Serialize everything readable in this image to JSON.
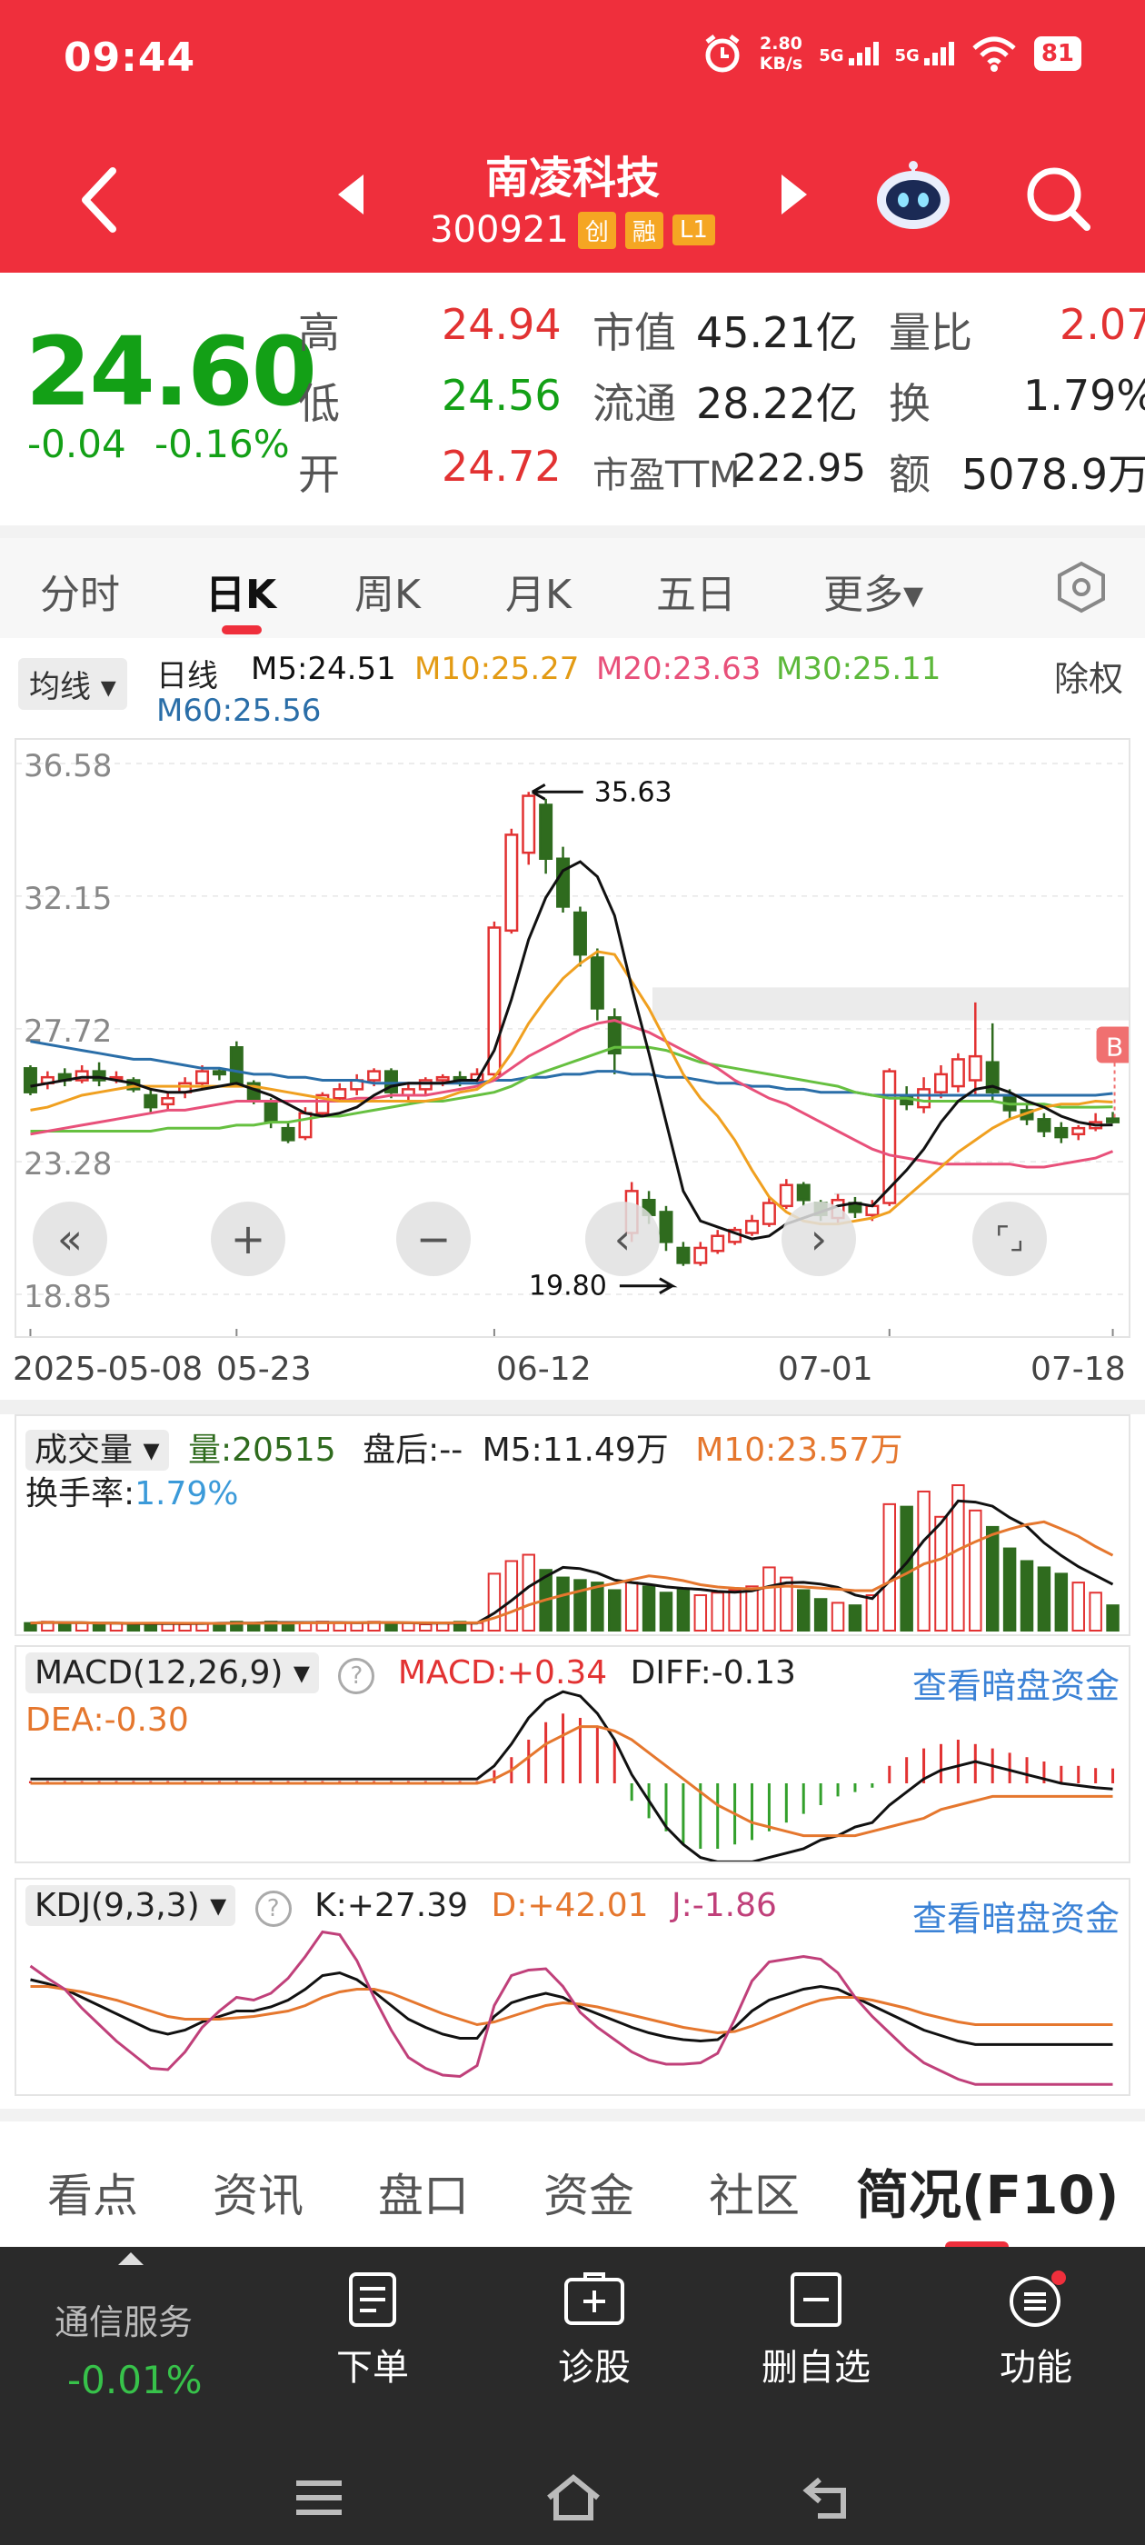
{
  "status": {
    "time": "09:44",
    "net_speed_top": "2.80",
    "net_speed_bottom": "KB/s",
    "sig1": "5G",
    "sig2": "5G",
    "battery": "81"
  },
  "header": {
    "name": "南凌科技",
    "code": "300921",
    "tags": [
      "创",
      "融",
      "L1"
    ]
  },
  "quote": {
    "price": "24.60",
    "change": "-0.04",
    "change_pct": "-0.16%",
    "high_label": "高",
    "high": "24.94",
    "low_label": "低",
    "low": "24.56",
    "open_label": "开",
    "open": "24.72",
    "mcap_label": "市值",
    "mcap": "45.21亿",
    "float_label": "流通",
    "float": "28.22亿",
    "pe_label": "市盈TTM",
    "pe": "222.95",
    "vr_label": "量比",
    "vr": "2.07",
    "turn_label": "换",
    "turn": "1.79%",
    "amt_label": "额",
    "amt": "5078.9万"
  },
  "period_tabs": [
    "分时",
    "日K",
    "周K",
    "月K",
    "五日",
    "更多▾"
  ],
  "ma_legend": {
    "select": "均线 ▾",
    "period": "日线",
    "m5": "M5:24.51",
    "m10": "M10:25.27",
    "m20": "M20:23.63",
    "m30": "M30:25.11",
    "m60": "M60:25.56",
    "fq": "除权"
  },
  "colors": {
    "brand": "#ef2f3c",
    "up": "#e23232",
    "down": "#2f6b1e",
    "ma5": "#111111",
    "ma10": "#f0a020",
    "ma20": "#e8507a",
    "ma30": "#66c040",
    "ma60": "#2a6ea8",
    "blue_link": "#3b82d6"
  },
  "chart_data": {
    "type": "candlestick",
    "y_ticks": [
      "36.58",
      "32.15",
      "27.72",
      "23.28",
      "18.85"
    ],
    "ylim": [
      18.85,
      36.58
    ],
    "x_labels": [
      "2025-05-08",
      "05-23",
      "06-12",
      "07-01",
      "07-18"
    ],
    "max_label": "35.63",
    "min_label": "19.80",
    "badge": "B",
    "candles": [
      [
        26.4,
        25.6,
        26.5,
        25.5
      ],
      [
        25.9,
        26.1,
        26.3,
        25.7
      ],
      [
        26.2,
        26.0,
        26.4,
        25.8
      ],
      [
        26.0,
        26.3,
        26.5,
        25.9
      ],
      [
        26.3,
        26.0,
        26.6,
        25.8
      ],
      [
        26.1,
        26.1,
        26.3,
        25.9
      ],
      [
        26.0,
        25.7,
        26.1,
        25.6
      ],
      [
        25.5,
        25.1,
        25.7,
        24.9
      ],
      [
        25.2,
        25.4,
        25.6,
        25.0
      ],
      [
        25.6,
        25.9,
        26.1,
        25.4
      ],
      [
        25.9,
        26.3,
        26.5,
        25.7
      ],
      [
        26.3,
        26.2,
        26.4,
        26.0
      ],
      [
        27.1,
        25.9,
        27.3,
        25.8
      ],
      [
        25.9,
        25.3,
        26.0,
        25.2
      ],
      [
        25.3,
        24.6,
        25.4,
        24.4
      ],
      [
        24.4,
        24.0,
        24.6,
        23.9
      ],
      [
        24.1,
        24.9,
        25.1,
        24.0
      ],
      [
        24.9,
        25.5,
        25.6,
        24.8
      ],
      [
        25.4,
        25.7,
        25.9,
        25.3
      ],
      [
        25.7,
        26.0,
        26.2,
        25.5
      ],
      [
        26.0,
        26.3,
        26.4,
        25.8
      ],
      [
        26.3,
        25.6,
        26.4,
        25.4
      ],
      [
        25.5,
        25.7,
        25.9,
        25.3
      ],
      [
        25.7,
        26.0,
        26.1,
        25.5
      ],
      [
        26.0,
        26.1,
        26.2,
        25.8
      ],
      [
        26.1,
        26.0,
        26.3,
        25.8
      ],
      [
        26.0,
        26.2,
        26.4,
        25.9
      ],
      [
        26.2,
        31.1,
        31.3,
        26.1
      ],
      [
        31.0,
        34.2,
        34.4,
        30.9
      ],
      [
        33.6,
        35.5,
        35.63,
        33.2
      ],
      [
        35.2,
        33.4,
        35.4,
        32.9
      ],
      [
        33.4,
        31.8,
        33.8,
        31.6
      ],
      [
        31.6,
        30.2,
        31.8,
        29.8
      ],
      [
        30.1,
        28.4,
        30.4,
        28.0
      ],
      [
        28.1,
        26.9,
        28.4,
        26.2
      ],
      [
        20.9,
        22.3,
        22.6,
        20.6
      ],
      [
        22.0,
        21.5,
        22.3,
        21.2
      ],
      [
        21.6,
        20.6,
        21.8,
        20.3
      ],
      [
        20.4,
        19.9,
        20.6,
        19.8
      ],
      [
        19.9,
        20.4,
        20.6,
        19.8
      ],
      [
        20.3,
        20.8,
        21.0,
        20.2
      ],
      [
        20.6,
        21.0,
        21.1,
        20.5
      ],
      [
        20.9,
        21.3,
        21.5,
        20.8
      ],
      [
        21.2,
        21.9,
        22.1,
        21.1
      ],
      [
        21.8,
        22.5,
        22.7,
        21.7
      ],
      [
        22.5,
        22.0,
        22.6,
        21.8
      ],
      [
        21.9,
        21.5,
        22.0,
        21.3
      ],
      [
        21.4,
        22.0,
        22.2,
        21.2
      ],
      [
        21.9,
        21.6,
        22.1,
        21.4
      ],
      [
        21.5,
        21.8,
        22.0,
        21.3
      ],
      [
        21.9,
        26.3,
        26.4,
        21.8
      ],
      [
        25.5,
        25.2,
        25.8,
        25.0
      ],
      [
        25.1,
        25.7,
        26.1,
        24.9
      ],
      [
        25.6,
        26.2,
        26.5,
        25.4
      ],
      [
        25.8,
        26.7,
        26.9,
        25.6
      ],
      [
        26.0,
        26.8,
        28.6,
        25.5
      ],
      [
        26.6,
        25.6,
        27.9,
        25.3
      ],
      [
        25.5,
        25.0,
        25.7,
        24.7
      ],
      [
        25.0,
        24.7,
        25.2,
        24.5
      ],
      [
        24.7,
        24.3,
        24.9,
        24.1
      ],
      [
        24.4,
        24.1,
        24.6,
        23.9
      ],
      [
        24.2,
        24.4,
        24.5,
        24.0
      ],
      [
        24.4,
        24.6,
        24.9,
        24.3
      ],
      [
        24.72,
        24.6,
        24.94,
        24.56
      ]
    ],
    "ma5": [
      25.8,
      25.9,
      26.0,
      26.1,
      26.1,
      26.0,
      25.9,
      25.7,
      25.6,
      25.6,
      25.7,
      25.8,
      25.9,
      25.7,
      25.5,
      25.2,
      24.9,
      24.8,
      24.9,
      25.1,
      25.5,
      25.8,
      25.9,
      25.9,
      25.9,
      26.0,
      26.0,
      27.0,
      28.7,
      30.7,
      32.1,
      33.0,
      33.3,
      32.8,
      31.5,
      29.1,
      26.9,
      24.6,
      22.3,
      21.3,
      21.1,
      20.9,
      20.7,
      20.8,
      21.2,
      21.4,
      21.6,
      21.8,
      21.9,
      21.8,
      22.4,
      23.0,
      23.7,
      24.6,
      25.3,
      25.7,
      25.8,
      25.6,
      25.3,
      25.1,
      24.8,
      24.6,
      24.5,
      24.51
    ],
    "ma10": [
      25.0,
      25.1,
      25.3,
      25.5,
      25.6,
      25.7,
      25.8,
      25.8,
      25.8,
      25.8,
      25.8,
      25.8,
      25.8,
      25.8,
      25.7,
      25.6,
      25.5,
      25.4,
      25.3,
      25.3,
      25.3,
      25.3,
      25.3,
      25.3,
      25.4,
      25.6,
      25.7,
      26.1,
      26.9,
      27.9,
      28.7,
      29.4,
      29.9,
      30.3,
      30.2,
      29.3,
      28.4,
      27.3,
      26.2,
      25.4,
      24.8,
      24.0,
      23.0,
      22.1,
      21.6,
      21.3,
      21.2,
      21.2,
      21.3,
      21.4,
      21.6,
      22.1,
      22.6,
      23.1,
      23.6,
      24.0,
      24.4,
      24.7,
      24.9,
      25.1,
      25.2,
      25.2,
      25.3,
      25.27
    ],
    "ma20": [
      24.2,
      24.3,
      24.4,
      24.5,
      24.6,
      24.7,
      24.8,
      24.9,
      25.0,
      25.0,
      25.1,
      25.2,
      25.3,
      25.3,
      25.3,
      25.3,
      25.3,
      25.3,
      25.3,
      25.4,
      25.4,
      25.5,
      25.5,
      25.5,
      25.6,
      25.7,
      25.8,
      26.0,
      26.4,
      26.8,
      27.1,
      27.4,
      27.7,
      27.9,
      28.0,
      27.8,
      27.6,
      27.3,
      27.0,
      26.7,
      26.4,
      26.0,
      25.7,
      25.4,
      25.2,
      24.9,
      24.6,
      24.3,
      24.0,
      23.7,
      23.5,
      23.4,
      23.3,
      23.2,
      23.2,
      23.2,
      23.2,
      23.2,
      23.1,
      23.1,
      23.2,
      23.3,
      23.4,
      23.63
    ],
    "ma30": [
      24.3,
      24.3,
      24.3,
      24.3,
      24.3,
      24.3,
      24.3,
      24.3,
      24.4,
      24.4,
      24.4,
      24.4,
      24.5,
      24.5,
      24.6,
      24.6,
      24.7,
      24.8,
      24.8,
      24.9,
      25.0,
      25.1,
      25.2,
      25.3,
      25.3,
      25.4,
      25.5,
      25.6,
      25.8,
      26.1,
      26.3,
      26.5,
      26.7,
      26.9,
      27.1,
      27.1,
      27.1,
      27.0,
      26.8,
      26.6,
      26.5,
      26.4,
      26.3,
      26.2,
      26.1,
      26.0,
      25.9,
      25.8,
      25.6,
      25.5,
      25.4,
      25.4,
      25.3,
      25.3,
      25.3,
      25.3,
      25.3,
      25.2,
      25.2,
      25.2,
      25.1,
      25.1,
      25.1,
      25.11
    ],
    "ma60": [
      27.3,
      27.2,
      27.1,
      27.0,
      26.9,
      26.8,
      26.7,
      26.7,
      26.6,
      26.5,
      26.4,
      26.4,
      26.3,
      26.2,
      26.2,
      26.1,
      26.1,
      26.0,
      26.0,
      26.0,
      25.9,
      25.9,
      25.9,
      25.9,
      25.9,
      25.9,
      25.9,
      26.0,
      26.0,
      26.1,
      26.1,
      26.2,
      26.2,
      26.3,
      26.3,
      26.2,
      26.2,
      26.1,
      26.1,
      26.0,
      25.9,
      25.9,
      25.8,
      25.8,
      25.7,
      25.7,
      25.6,
      25.6,
      25.6,
      25.5,
      25.5,
      25.5,
      25.5,
      25.5,
      25.5,
      25.5,
      25.5,
      25.5,
      25.5,
      25.5,
      25.5,
      25.5,
      25.5,
      25.56
    ],
    "volume": [
      6,
      7,
      6,
      6,
      5,
      6,
      5,
      6,
      6,
      5,
      6,
      6,
      7,
      6,
      7,
      6,
      6,
      7,
      6,
      6,
      7,
      6,
      6,
      5,
      6,
      7,
      6,
      45,
      55,
      60,
      48,
      42,
      40,
      38,
      32,
      38,
      35,
      30,
      32,
      28,
      30,
      32,
      35,
      50,
      42,
      32,
      25,
      22,
      20,
      28,
      100,
      98,
      110,
      90,
      115,
      95,
      82,
      65,
      55,
      50,
      45,
      38,
      30,
      20
    ],
    "macd_hist": [
      0.05,
      0.05,
      0.05,
      0.05,
      0.05,
      0.05,
      0.05,
      0.05,
      0.05,
      0.05,
      0.05,
      0.05,
      0.05,
      0.05,
      0.05,
      0.05,
      0.05,
      0.05,
      0.05,
      0.05,
      0.05,
      0.05,
      0.05,
      0.05,
      0.05,
      0.05,
      0.05,
      0.3,
      0.6,
      1.0,
      1.4,
      1.6,
      1.5,
      1.3,
      1.0,
      -0.4,
      -0.8,
      -1.1,
      -1.4,
      -1.5,
      -1.5,
      -1.4,
      -1.3,
      -1.1,
      -0.9,
      -0.7,
      -0.5,
      -0.3,
      -0.2,
      -0.1,
      0.4,
      0.6,
      0.8,
      0.9,
      1.0,
      0.9,
      0.8,
      0.7,
      0.6,
      0.5,
      0.4,
      0.4,
      0.35,
      0.34
    ],
    "diff": [
      0.1,
      0.1,
      0.1,
      0.1,
      0.1,
      0.1,
      0.1,
      0.1,
      0.1,
      0.1,
      0.1,
      0.1,
      0.1,
      0.1,
      0.1,
      0.1,
      0.1,
      0.1,
      0.1,
      0.1,
      0.1,
      0.1,
      0.1,
      0.1,
      0.1,
      0.1,
      0.1,
      0.4,
      0.9,
      1.5,
      1.9,
      2.1,
      2.0,
      1.6,
      1.0,
      0.2,
      -0.4,
      -1.0,
      -1.4,
      -1.7,
      -1.8,
      -1.8,
      -1.8,
      -1.7,
      -1.6,
      -1.5,
      -1.3,
      -1.2,
      -1.0,
      -0.9,
      -0.5,
      -0.2,
      0.1,
      0.3,
      0.4,
      0.5,
      0.4,
      0.3,
      0.2,
      0.1,
      0.0,
      -0.05,
      -0.1,
      -0.13
    ],
    "dea": [
      0.0,
      0.0,
      0.0,
      0.0,
      0.0,
      0.0,
      0.0,
      0.0,
      0.0,
      0.0,
      0.0,
      0.0,
      0.0,
      0.0,
      0.0,
      0.0,
      0.0,
      0.0,
      0.0,
      0.0,
      0.0,
      0.0,
      0.0,
      0.0,
      0.0,
      0.0,
      0.0,
      0.1,
      0.3,
      0.6,
      0.9,
      1.1,
      1.3,
      1.3,
      1.2,
      1.0,
      0.7,
      0.4,
      0.1,
      -0.2,
      -0.5,
      -0.7,
      -0.9,
      -1.0,
      -1.1,
      -1.2,
      -1.2,
      -1.2,
      -1.2,
      -1.1,
      -1.0,
      -0.9,
      -0.8,
      -0.6,
      -0.5,
      -0.4,
      -0.3,
      -0.3,
      -0.3,
      -0.3,
      -0.3,
      -0.3,
      -0.3,
      -0.3
    ],
    "kdj_k": [
      75,
      72,
      68,
      62,
      56,
      50,
      44,
      38,
      35,
      38,
      44,
      48,
      52,
      52,
      55,
      60,
      68,
      78,
      80,
      75,
      66,
      56,
      46,
      40,
      35,
      32,
      32,
      48,
      58,
      62,
      65,
      62,
      55,
      50,
      45,
      40,
      36,
      33,
      31,
      30,
      31,
      40,
      52,
      60,
      64,
      68,
      70,
      68,
      62,
      56,
      50,
      44,
      38,
      34,
      30,
      27.39,
      27.4,
      27.4,
      27.4,
      27.4,
      27.4,
      27.4,
      27.4,
      27.39
    ],
    "kdj_d": [
      70,
      70,
      68,
      66,
      63,
      60,
      56,
      52,
      48,
      46,
      46,
      46,
      47,
      48,
      50,
      52,
      56,
      62,
      66,
      68,
      68,
      65,
      60,
      55,
      50,
      46,
      42,
      44,
      48,
      52,
      56,
      58,
      57,
      55,
      52,
      49,
      46,
      43,
      40,
      38,
      36,
      37,
      41,
      46,
      51,
      56,
      60,
      62,
      62,
      60,
      57,
      54,
      50,
      47,
      44,
      42.01,
      42,
      42,
      42,
      42,
      42,
      42,
      42,
      42.01
    ],
    "kdj_j": [
      85,
      76,
      68,
      54,
      42,
      30,
      20,
      10,
      9,
      22,
      40,
      52,
      62,
      60,
      65,
      76,
      92,
      110,
      108,
      89,
      62,
      38,
      18,
      10,
      5,
      4,
      12,
      56,
      78,
      82,
      83,
      70,
      51,
      40,
      31,
      22,
      16,
      13,
      13,
      14,
      21,
      46,
      74,
      88,
      90,
      92,
      90,
      80,
      62,
      48,
      36,
      24,
      14,
      8,
      2,
      -1.86,
      -1.9,
      -1.9,
      -1.9,
      -1.9,
      -1.9,
      -1.9,
      -1.9,
      -1.86
    ]
  },
  "ctrl": {
    "left": "«",
    "plus": "+",
    "minus": "−",
    "prev": "‹",
    "next": "›",
    "full": "⌜⌟"
  },
  "vol": {
    "select": "成交量 ▾",
    "qty": "量:20515",
    "after": "盘后:--",
    "m5": "M5:11.49万",
    "m10": "M10:23.57万",
    "turn_label": "换手率:",
    "turn": "1.79%"
  },
  "macd": {
    "select": "MACD(12,26,9) ▾",
    "help": "?",
    "macd": "MACD:+0.34",
    "diff": "DIFF:-0.13",
    "dea": "DEA:-0.30",
    "link": "查看暗盘资金"
  },
  "kdj": {
    "select": "KDJ(9,3,3) ▾",
    "help": "?",
    "k": "K:+27.39",
    "d": "D:+42.01",
    "j": "J:-1.86",
    "link": "查看暗盘资金"
  },
  "info_tabs": [
    "看点",
    "资讯",
    "盘口",
    "资金",
    "社区",
    "简况(F10)"
  ],
  "bottom": {
    "index_name": "通信服务",
    "index_chg": "-0.01%",
    "items": [
      "下单",
      "诊股",
      "删自选",
      "功能"
    ]
  }
}
